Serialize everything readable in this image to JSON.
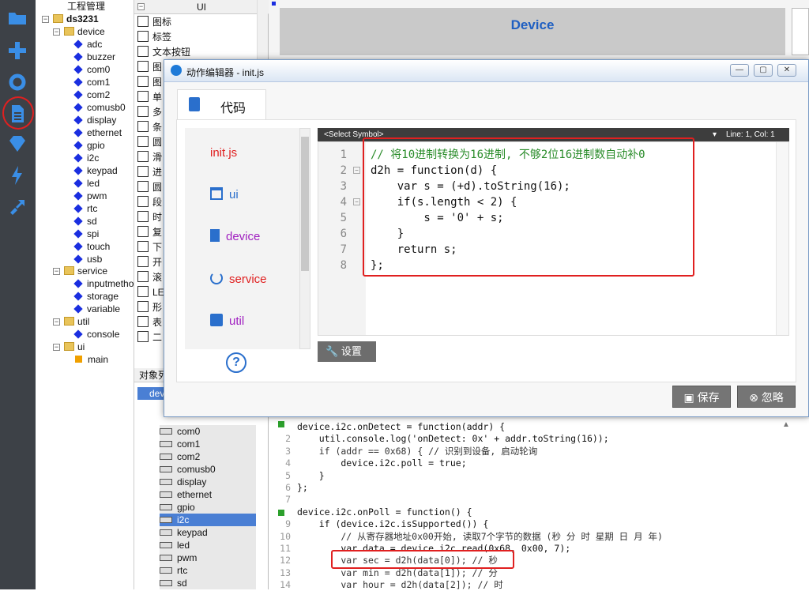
{
  "toolbar": {
    "icons": [
      "folder-icon",
      "plus-icon",
      "gear-icon",
      "document-icon",
      "gem-icon",
      "lightning-icon",
      "deploy-icon"
    ]
  },
  "tree": {
    "header": "工程管理",
    "root": "ds3231",
    "device_folder": "device",
    "device_items": [
      "adc",
      "buzzer",
      "com0",
      "com1",
      "com2",
      "comusb0",
      "display",
      "ethernet",
      "gpio",
      "i2c",
      "keypad",
      "led",
      "pwm",
      "rtc",
      "sd",
      "spi",
      "touch",
      "usb"
    ],
    "service_folder": "service",
    "service_items": [
      "inputmetho",
      "storage",
      "variable"
    ],
    "util_folder": "util",
    "util_items": [
      "console"
    ],
    "ui_folder": "ui",
    "ui_items": [
      "main"
    ]
  },
  "uipanel": {
    "header": "UI",
    "items": [
      "图标",
      "标签",
      "文本按钮",
      "图",
      "图",
      "单",
      "多",
      "条",
      "圆",
      "滑",
      "进",
      "圆",
      "段",
      "时",
      "复",
      "下",
      "开",
      "滚",
      "LE",
      "形",
      "表",
      "二"
    ]
  },
  "objpanel": {
    "header": "对象列",
    "first": "dev",
    "items": [
      "com0",
      "com1",
      "com2",
      "comusb0",
      "display",
      "ethernet",
      "gpio",
      "i2c",
      "keypad",
      "led",
      "pwm",
      "rtc",
      "sd"
    ]
  },
  "right": {
    "title": "Device"
  },
  "dialog": {
    "title": "动作编辑器 - init.js",
    "tab": "代码",
    "nav": [
      "init.js",
      "ui",
      "device",
      "service",
      "util"
    ],
    "symbol_select": "<Select Symbol>",
    "position": "Line: 1, Col: 1",
    "code": [
      "// 将10进制转换为16进制, 不够2位16进制数自动补0",
      "d2h = function(d) {",
      "    var s = (+d).toString(16);",
      "    if(s.length < 2) {",
      "        s = '0' + s;",
      "    }",
      "    return s;",
      "};"
    ],
    "line_numbers": [
      "1",
      "2",
      "3",
      "4",
      "5",
      "6",
      "7",
      "8"
    ],
    "help": "?",
    "settings": "设置",
    "save": "保存",
    "ignore": "忽略",
    "win_buttons": [
      "—",
      "▢",
      "✕"
    ]
  },
  "bgcode": [
    {
      "n": "",
      "t": "device.i2c.onDetect = function(addr) {"
    },
    {
      "n": "2",
      "t": "    util.console.log('onDetect: 0x' + addr.toString(16));"
    },
    {
      "n": "3",
      "t": "    if (addr == 0x68) { // 识别到设备, 启动轮询"
    },
    {
      "n": "4",
      "t": "        device.i2c.poll = true;"
    },
    {
      "n": "5",
      "t": "    }"
    },
    {
      "n": "6",
      "t": "};"
    },
    {
      "n": "7",
      "t": ""
    },
    {
      "n": "",
      "t": "device.i2c.onPoll = function() {"
    },
    {
      "n": "9",
      "t": "    if (device.i2c.isSupported()) {"
    },
    {
      "n": "10",
      "t": "        // 从寄存器地址0x00开始, 读取7个字节的数据 (秒 分 时 星期 日 月 年)"
    },
    {
      "n": "11",
      "t": "        var data = device.i2c.read(0x68, 0x00, 7);"
    },
    {
      "n": "12",
      "t": "        var sec = d2h(data[0]); // 秒"
    },
    {
      "n": "13",
      "t": "        var min = d2h(data[1]); // 分"
    },
    {
      "n": "14",
      "t": "        var hour = d2h(data[2]); // 时"
    }
  ]
}
